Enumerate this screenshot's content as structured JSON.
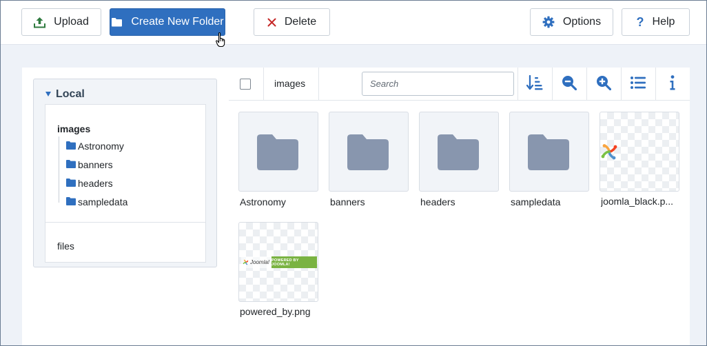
{
  "toolbar": {
    "upload_label": "Upload",
    "create_folder_label": "Create New Folder",
    "delete_label": "Delete",
    "options_label": "Options",
    "help_label": "Help"
  },
  "tree": {
    "heading": "Local",
    "root": "images",
    "folders": [
      "Astronomy",
      "banners",
      "headers",
      "sampledata"
    ],
    "files_label": "files"
  },
  "browser": {
    "breadcrumb": "images",
    "search_placeholder": "Search",
    "items": [
      {
        "name": "Astronomy",
        "type": "folder"
      },
      {
        "name": "banners",
        "type": "folder"
      },
      {
        "name": "headers",
        "type": "folder"
      },
      {
        "name": "sampledata",
        "type": "folder"
      },
      {
        "name": "joomla_black.p...",
        "type": "image"
      },
      {
        "name": "powered_by.png",
        "type": "image"
      }
    ],
    "powered_text": "POWERED BY JOOMLA!",
    "joomla_wordmark": "Joomla!"
  },
  "colors": {
    "primary": "#2f6fbf",
    "folder_tile": "#8896ae",
    "tree_folder": "#2f6fbf",
    "delete_x": "#c52827",
    "upload_icon": "#2f7a3f"
  },
  "icons": [
    "upload-icon",
    "folder-icon",
    "close-icon",
    "gear-icon",
    "question-icon",
    "sort-icon",
    "zoom-out-icon",
    "zoom-in-icon",
    "list-icon",
    "info-icon",
    "caret-down-icon",
    "hand-cursor-icon"
  ]
}
